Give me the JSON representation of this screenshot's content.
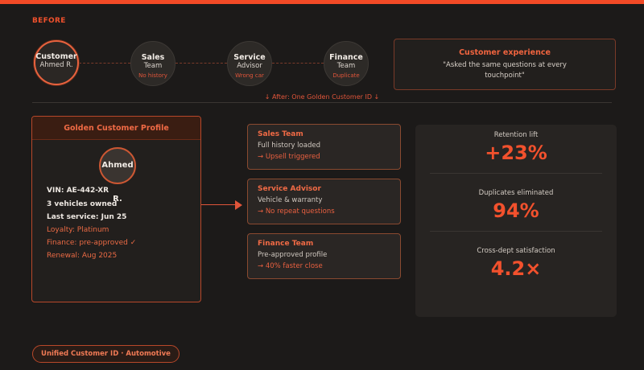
{
  "header": {
    "before_label": "BEFORE"
  },
  "journey": [
    {
      "title": "Customer",
      "subtitle": "Ahmed R.",
      "note": ""
    },
    {
      "title": "Sales",
      "subtitle": "Team",
      "note": "No history"
    },
    {
      "title": "Service",
      "subtitle": "Advisor",
      "note": "Wrong car"
    },
    {
      "title": "Finance",
      "subtitle": "Team",
      "note": "Duplicate"
    }
  ],
  "experience": {
    "title": "Customer experience",
    "quote": "\"Asked the same questions at every touchpoint\""
  },
  "after_label": "↓  After: One Golden Customer ID  ↓",
  "profile": {
    "header": "Golden Customer Profile",
    "name": "Ahmed R.",
    "vin": "VIN: AE-442-XR",
    "vehicles": "3 vehicles owned",
    "last_service": "Last service: Jun 25",
    "loyalty": "Loyalty: Platinum",
    "finance": "Finance: pre-approved ✓",
    "renewal": "Renewal: Aug 2025"
  },
  "cards": [
    {
      "title": "Sales Team",
      "status": "Full history loaded",
      "outcome": "→ Upsell triggered"
    },
    {
      "title": "Service Advisor",
      "status": "Vehicle & warranty",
      "outcome": "→ No repeat questions"
    },
    {
      "title": "Finance Team",
      "status": "Pre-approved profile",
      "outcome": "→ 40% faster close"
    }
  ],
  "metrics": [
    {
      "label": "Retention lift",
      "value": "+23%"
    },
    {
      "label": "Duplicates eliminated",
      "value": "94%"
    },
    {
      "label": "Cross-dept satisfaction",
      "value": "4.2×"
    }
  ],
  "footer": {
    "pill": "Unified Customer ID · Automotive"
  },
  "colors": {
    "accent": "#f24a26",
    "background": "#1c1a19",
    "card": "#2a2624"
  }
}
